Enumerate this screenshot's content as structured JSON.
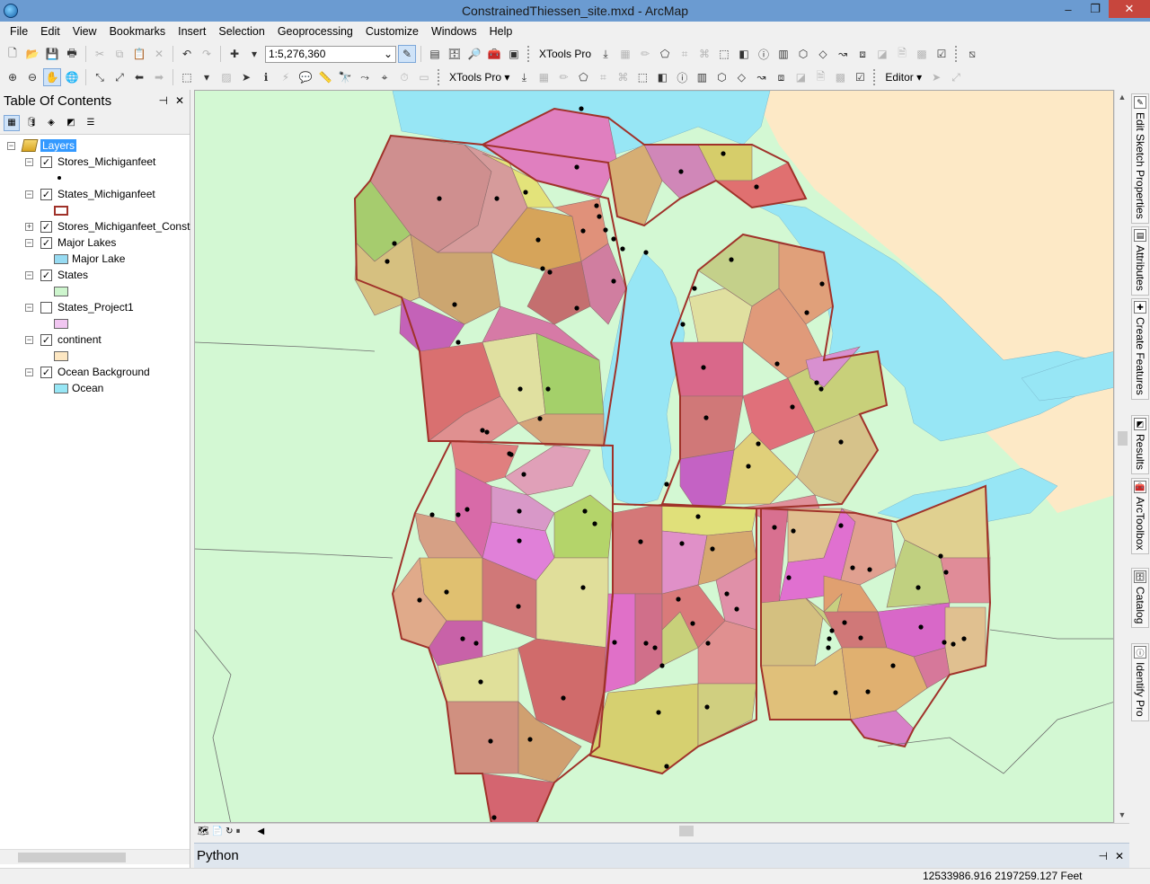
{
  "window": {
    "title": "ConstrainedThiessen_site.mxd - ArcMap",
    "controls": {
      "minimize": "–",
      "maximize": "❐",
      "close": "✕"
    }
  },
  "menu": [
    "File",
    "Edit",
    "View",
    "Bookmarks",
    "Insert",
    "Selection",
    "Geoprocessing",
    "Customize",
    "Windows",
    "Help"
  ],
  "toolbar": {
    "scale_value": "1:5,276,360",
    "xtools_label": "XTools Pro",
    "xtools_dropdown": "XTools Pro ▾",
    "editor_label": "Editor ▾"
  },
  "toc": {
    "title": "Table Of Contents",
    "pin": "⊣",
    "close": "✕",
    "root_label": "Layers",
    "layers": [
      {
        "name": "Stores_Michiganfeet",
        "checked": true,
        "expanded": true,
        "symbol": "dot"
      },
      {
        "name": "States_Michiganfeet",
        "checked": true,
        "expanded": true,
        "symbol": "outline",
        "color": "#a0322a"
      },
      {
        "name": "Stores_Michiganfeet_Const",
        "checked": true,
        "expanded": false,
        "symbol": "none"
      },
      {
        "name": "Major Lakes",
        "checked": true,
        "expanded": true,
        "symbol": "fill",
        "color": "#97dbf2",
        "class_label": "Major Lake"
      },
      {
        "name": "States",
        "checked": true,
        "expanded": true,
        "symbol": "fill",
        "color": "#cdf5cd"
      },
      {
        "name": "States_Project1",
        "checked": false,
        "expanded": true,
        "symbol": "fill",
        "color": "#f1c6f1"
      },
      {
        "name": "continent",
        "checked": true,
        "expanded": true,
        "symbol": "fill",
        "color": "#fde7c2"
      },
      {
        "name": "Ocean Background",
        "checked": true,
        "expanded": true,
        "symbol": "fill",
        "color": "#97e6f5",
        "class_label": "Ocean"
      }
    ]
  },
  "side_tabs": [
    "Edit Sketch Properties",
    "Attributes",
    "Create Features",
    "Results",
    "ArcToolbox",
    "Catalog",
    "Identify Pro"
  ],
  "python_pane": {
    "title": "Python",
    "pin": "⊣",
    "close": "✕"
  },
  "status": {
    "coordinates": "12533986.916  2197259.127 Feet"
  },
  "map": {
    "colors": {
      "land": "#d3f8d3",
      "continent": "#fde9c6",
      "lake": "#97e6f5",
      "state_outline": "#a0322a",
      "store_point": "#000000"
    }
  }
}
